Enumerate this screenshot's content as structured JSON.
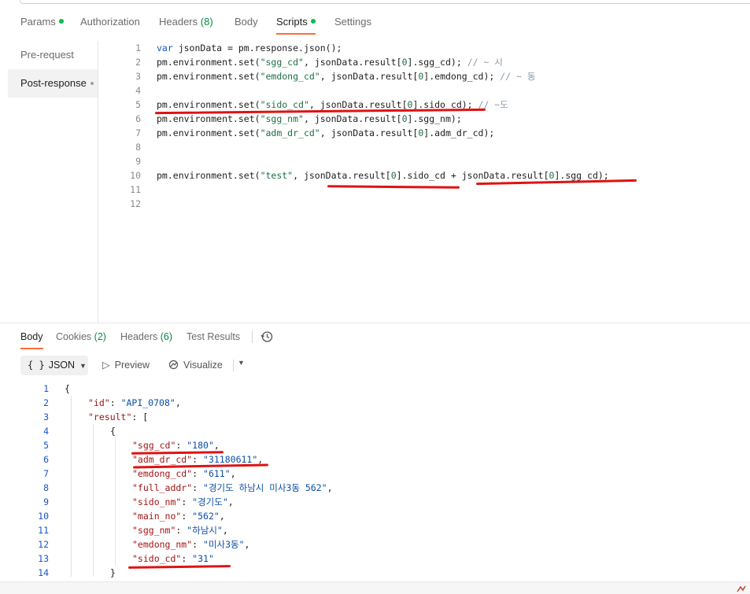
{
  "request_tabs": {
    "params": "Params",
    "authorization": "Authorization",
    "headers": "Headers",
    "headers_count": "(8)",
    "body": "Body",
    "scripts": "Scripts",
    "settings": "Settings"
  },
  "script_nav": {
    "pre_request": "Pre-request",
    "post_response": "Post-response"
  },
  "script_lines": [
    {
      "n": "1"
    },
    {
      "n": "2"
    },
    {
      "n": "3"
    },
    {
      "n": "4"
    },
    {
      "n": "5"
    },
    {
      "n": "6"
    },
    {
      "n": "7"
    },
    {
      "n": "8"
    },
    {
      "n": "9"
    },
    {
      "n": "10"
    },
    {
      "n": "11"
    },
    {
      "n": "12"
    }
  ],
  "script_code": {
    "l1_kw": "var",
    "l1_rest": " jsonData = pm.response.json();",
    "l2_a": "pm.environment.set(",
    "l2_str": "\"sgg_cd\"",
    "l2_b": ", jsonData.result[",
    "l2_num": "0",
    "l2_c": "].sgg_cd); ",
    "l2_cmt": "// ~ 시",
    "l3_a": "pm.environment.set(",
    "l3_str": "\"emdong_cd\"",
    "l3_b": ", jsonData.result[",
    "l3_num": "0",
    "l3_c": "].emdong_cd); ",
    "l3_cmt": "// ~ 동",
    "l5_a": "pm.environment.set(",
    "l5_str": "\"sido_cd\"",
    "l5_b": ", jsonData.result[",
    "l5_num": "0",
    "l5_c": "].sido_cd); ",
    "l5_cmt": "// ~도",
    "l6_a": "pm.environment.set(",
    "l6_str": "\"sgg_nm\"",
    "l6_b": ", jsonData.result[",
    "l6_num": "0",
    "l6_c": "].sgg_nm);",
    "l7_a": "pm.environment.set(",
    "l7_str": "\"adm_dr_cd\"",
    "l7_b": ", jsonData.result[",
    "l7_num": "0",
    "l7_c": "].adm_dr_cd);",
    "l10_a": "pm.environment.set(",
    "l10_str": "\"test\"",
    "l10_b": ", jsonData.result[",
    "l10_num": "0",
    "l10_c": "].sido_cd + jsonData.result[",
    "l10_num2": "0",
    "l10_d": "].sgg_cd);"
  },
  "response_tabs": {
    "body": "Body",
    "cookies": "Cookies",
    "cookies_count": "(2)",
    "headers": "Headers",
    "headers_count": "(6)",
    "test_results": "Test Results"
  },
  "format_bar": {
    "braces": "{ }",
    "format": "JSON",
    "preview": "Preview",
    "visualize": "Visualize"
  },
  "json_lines": [
    {
      "n": "1",
      "key": "",
      "val": "",
      "pre": "{",
      "post": ""
    },
    {
      "n": "2",
      "key": "\"id\"",
      "val": "\"API_0708\"",
      "pre": "",
      "post": ","
    },
    {
      "n": "3",
      "key": "\"result\"",
      "val": "",
      "pre": "",
      "post": ": ["
    },
    {
      "n": "4",
      "key": "",
      "val": "",
      "pre": "{",
      "post": ""
    },
    {
      "n": "5",
      "key": "\"sgg_cd\"",
      "val": "\"180\"",
      "pre": "",
      "post": ","
    },
    {
      "n": "6",
      "key": "\"adm_dr_cd\"",
      "val": "\"31180611\"",
      "pre": "",
      "post": ","
    },
    {
      "n": "7",
      "key": "\"emdong_cd\"",
      "val": "\"611\"",
      "pre": "",
      "post": ","
    },
    {
      "n": "8",
      "key": "\"full_addr\"",
      "val": "\"경기도 하남시 미사3동 562\"",
      "pre": "",
      "post": ","
    },
    {
      "n": "9",
      "key": "\"sido_nm\"",
      "val": "\"경기도\"",
      "pre": "",
      "post": ","
    },
    {
      "n": "10",
      "key": "\"main_no\"",
      "val": "\"562\"",
      "pre": "",
      "post": ","
    },
    {
      "n": "11",
      "key": "\"sgg_nm\"",
      "val": "\"하남시\"",
      "pre": "",
      "post": ","
    },
    {
      "n": "12",
      "key": "\"emdong_nm\"",
      "val": "\"미사3동\"",
      "pre": "",
      "post": ","
    },
    {
      "n": "13",
      "key": "\"sido_cd\"",
      "val": "\"31\"",
      "pre": "",
      "post": ""
    },
    {
      "n": "14",
      "key": "",
      "val": "",
      "pre": "}",
      "post": ""
    }
  ],
  "colors": {
    "accent": "#ff6c37",
    "status_dot": "#0cbb52",
    "annotation": "#e01212"
  },
  "icons": {
    "history": "history-icon",
    "preview": "play-outline-icon",
    "visualize": "visualize-icon",
    "dropdown": "chevron-down-icon"
  }
}
